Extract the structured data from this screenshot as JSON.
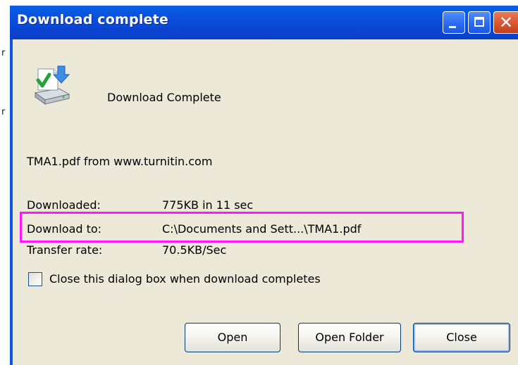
{
  "background": {
    "glyphs": [
      "r",
      "r"
    ]
  },
  "dialog": {
    "title": "Download complete",
    "heading": "Download Complete",
    "source": "TMA1.pdf from www.turnitin.com",
    "details": [
      {
        "label": "Downloaded:",
        "value": "775KB in 11 sec"
      },
      {
        "label": "Download to:",
        "value": "C:\\Documents and Sett...\\TMA1.pdf"
      },
      {
        "label": "Transfer rate:",
        "value": "70.5KB/Sec"
      }
    ],
    "checkbox": {
      "label": "Close this dialog box when download completes",
      "checked": false
    },
    "buttons": {
      "open": "Open",
      "open_folder": "Open Folder",
      "close": "Close"
    },
    "icons": {
      "download": "download-complete-icon",
      "minimize": "minimize-icon",
      "maximize": "maximize-icon",
      "close": "close-icon"
    }
  },
  "annotation": {
    "highlight_color": "#ff17ff"
  },
  "colors": {
    "titlebar": "#0a54e0",
    "dialog_bg": "#ece9d8",
    "close_button": "#d8522c"
  }
}
